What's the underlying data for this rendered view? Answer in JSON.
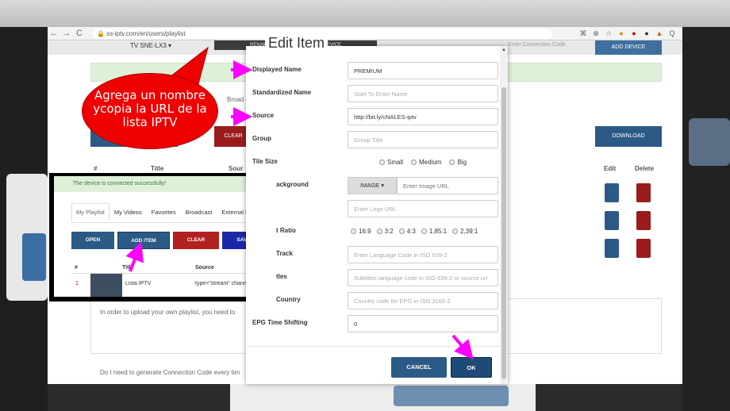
{
  "browser": {
    "url": "ss-iptv.com/en/users/playlist",
    "nav": {
      "back": "←",
      "forward": "→",
      "reload": "C"
    }
  },
  "page": {
    "tv_selector": "TV SNE-LX3 ▾",
    "rename_label": "RENAME DEVICE   DISCONNECT DEVICE",
    "add_device": "ADD DEVICE",
    "connection_code": "Enter Connection Code",
    "tabs_fragment": "Broad",
    "clear": "CLEAR",
    "download": "DOWNLOAD",
    "col_num": "#",
    "col_title": "Title",
    "col_source": "Sour",
    "col_edit": "Edit",
    "col_delete": "Delete",
    "info_text": "In order to upload your own playlist, you need to",
    "faq_text": "Do I need to generate Connection Code every tim"
  },
  "callout": {
    "text": "Agrega un nombre\nycopia la URL de la\nlista IPTV"
  },
  "inset": {
    "success_message": "The device is connected successfully!",
    "tabs": [
      "My Playlist",
      "My Videos",
      "Favorites",
      "Broadcast",
      "External Playl"
    ],
    "buttons": {
      "open": "OPEN",
      "add_item": "ADD ITEM",
      "clear": "CLEAR",
      "save": "SAVE"
    },
    "headers": {
      "num": "#",
      "title": "Title",
      "source": "Source"
    },
    "row": {
      "num": "1",
      "title": "Lista IPTV",
      "source": "type=\"stream\" channelId=\"-"
    }
  },
  "modal": {
    "title": "Edit Item",
    "fields": {
      "displayed_name": {
        "label": "Displayed Name",
        "value": "PREMIUM"
      },
      "standardized_name": {
        "label": "Standardized Name",
        "placeholder": "Start To Enter Name"
      },
      "source": {
        "label": "Source",
        "value": "http://bit.ly/cNALES-iptv"
      },
      "group": {
        "label": "Group",
        "placeholder": "Group Title"
      },
      "tile_size": {
        "label": "Tile Size",
        "options": [
          "Small",
          "Medium",
          "Big"
        ]
      },
      "background": {
        "label": "Background",
        "visible_label": "ackground",
        "button": "IMAGE ▾",
        "placeholder": "Enter Image URL"
      },
      "logo": {
        "label": "",
        "placeholder": "Enter Logo URL"
      },
      "aspect_ratio": {
        "label": "t Ratio",
        "options": [
          "16:9",
          "3:2",
          "4:3",
          "1,85:1",
          "2,39:1"
        ]
      },
      "audio_track": {
        "label": "Track",
        "placeholder": "Enter Language Code in ISO 639-2"
      },
      "subtitles": {
        "label": "tles",
        "placeholder": "Subtitles language code in ISO 639-2 or source url"
      },
      "country": {
        "label": "Country",
        "placeholder": "Country code for EPG in ISO 3166-2"
      },
      "epg_shift": {
        "label": "EPG Time Shifting",
        "value": "0"
      }
    },
    "buttons": {
      "cancel": "CANCEL",
      "ok": "OK"
    }
  },
  "colors": {
    "arrow": "#ff00ff",
    "callout": "#ee0000",
    "primary": "#2c5a86",
    "danger": "#9b1c1c"
  }
}
